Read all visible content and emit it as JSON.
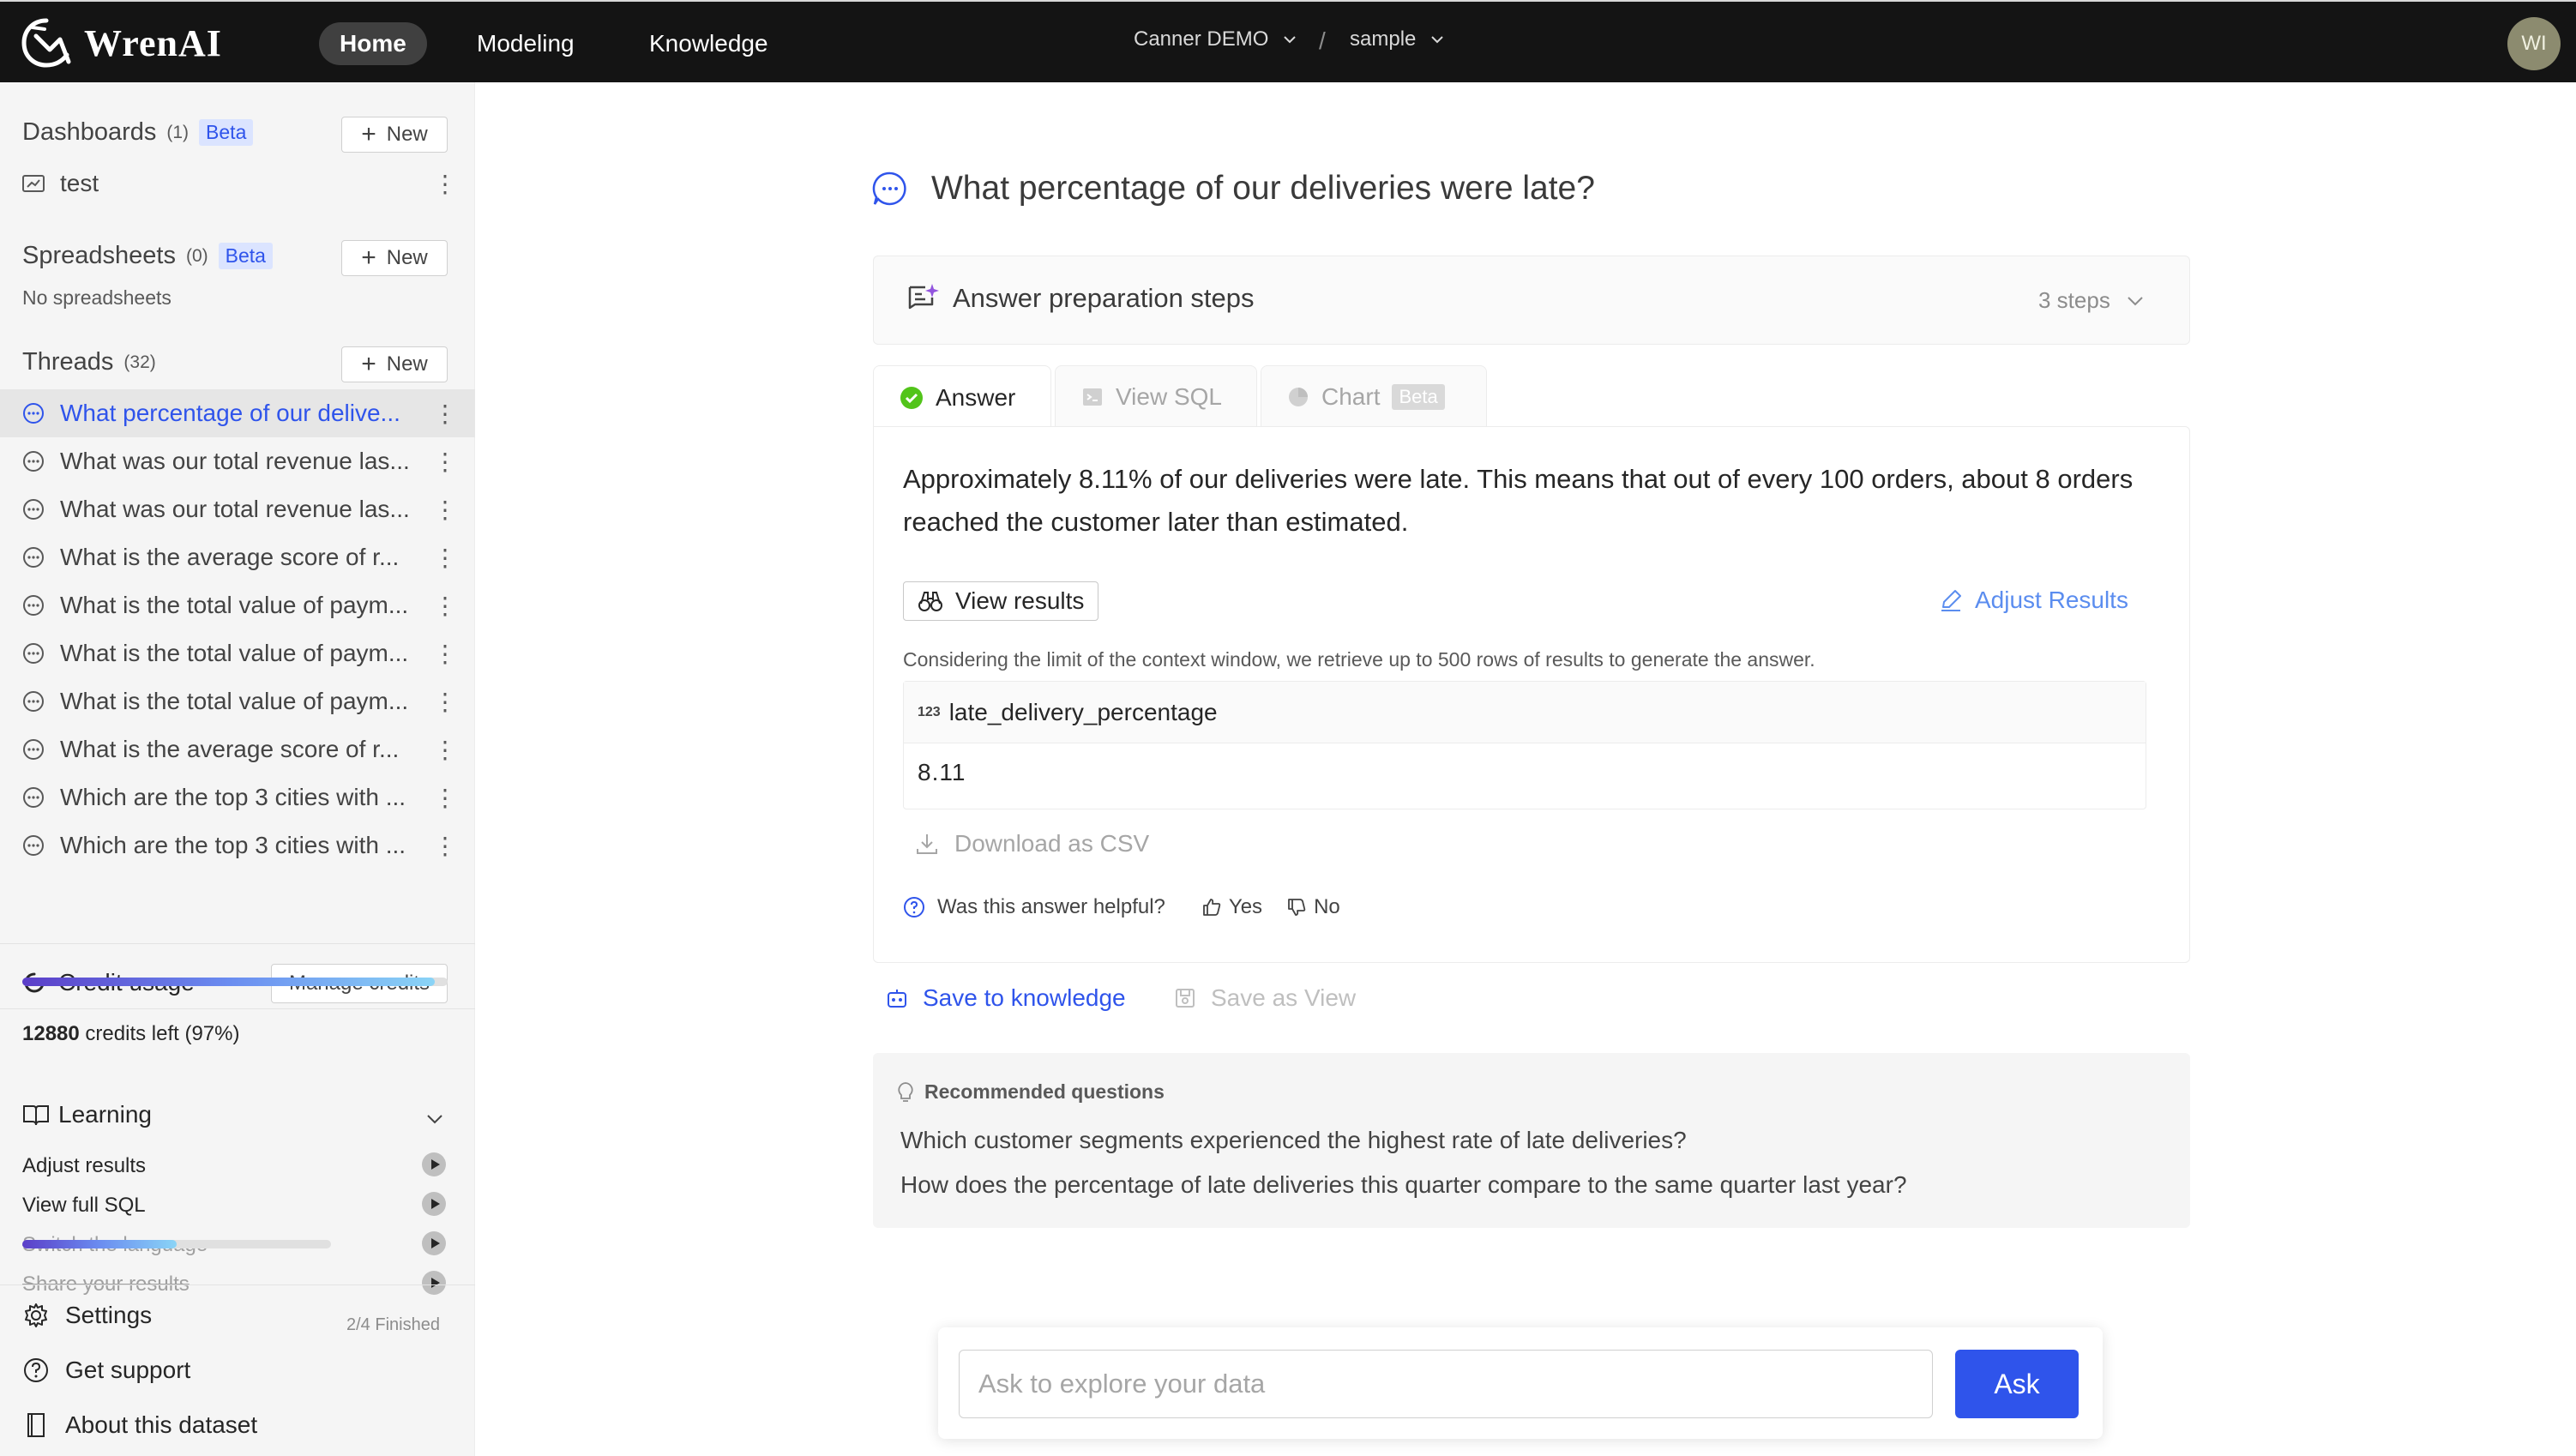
{
  "header": {
    "logo_text": "WrenAI",
    "nav": {
      "home": "Home",
      "modeling": "Modeling",
      "knowledge": "Knowledge"
    },
    "project": "Canner DEMO",
    "separator": "/",
    "dataset": "sample",
    "avatar_initials": "WI"
  },
  "sidebar": {
    "dashboards": {
      "title": "Dashboards",
      "count": "(1)",
      "badge": "Beta",
      "new_label": "New",
      "items": [
        {
          "label": "test"
        }
      ]
    },
    "spreadsheets": {
      "title": "Spreadsheets",
      "count": "(0)",
      "badge": "Beta",
      "new_label": "New",
      "empty_text": "No spreadsheets"
    },
    "threads": {
      "title": "Threads",
      "count": "(32)",
      "new_label": "New",
      "items": [
        {
          "label": "What percentage of our delive..."
        },
        {
          "label": "What was our total revenue las..."
        },
        {
          "label": "What was our total revenue las..."
        },
        {
          "label": "What is the average score of r..."
        },
        {
          "label": "What is the total value of paym..."
        },
        {
          "label": "What is the total value of paym..."
        },
        {
          "label": "What is the total value of paym..."
        },
        {
          "label": "What is the average score of r..."
        },
        {
          "label": "Which are the top 3 cities with ..."
        },
        {
          "label": "Which are the top 3 cities with ..."
        }
      ]
    },
    "credit": {
      "title": "Credit usage",
      "manage_label": "Manage credits",
      "amount": "12880",
      "suffix": "credits left (97%)",
      "percent": 97
    },
    "learning": {
      "title": "Learning",
      "items": [
        {
          "label": "Adjust results",
          "done": false
        },
        {
          "label": "View full SQL",
          "done": false
        },
        {
          "label": "Switch the language",
          "done": true
        },
        {
          "label": "Share your results",
          "done": true
        }
      ],
      "progress_text": "2/4 Finished",
      "progress": 0.5
    },
    "footer": {
      "settings": "Settings",
      "support": "Get support",
      "about": "About this dataset"
    }
  },
  "main": {
    "question": "What percentage of our deliveries were late?",
    "prep": {
      "label": "Answer preparation steps",
      "steps": "3 steps"
    },
    "tabs": {
      "answer": "Answer",
      "sql": "View SQL",
      "chart": "Chart",
      "chart_badge": "Beta"
    },
    "answer_text": "Approximately 8.11% of our deliveries were late. This means that out of every 100 orders, about 8 orders reached the customer later than estimated.",
    "view_results_label": "View results",
    "adjust_label": "Adjust Results",
    "context_note": "Considering the limit of the context window, we retrieve up to 500 rows of results to generate the answer.",
    "table": {
      "type_badge": "123",
      "column": "late_delivery_percentage",
      "value": "8.11"
    },
    "download_label": "Download as CSV",
    "feedback": {
      "question": "Was this answer helpful?",
      "yes": "Yes",
      "no": "No"
    },
    "save_knowledge": "Save to knowledge",
    "save_view": "Save as View",
    "recommended": {
      "title": "Recommended questions",
      "items": [
        "Which customer segments experienced the highest rate of late deliveries?",
        "How does the percentage of late deliveries this quarter compare to the same quarter last year?"
      ]
    },
    "ask": {
      "placeholder": "Ask to explore your data",
      "button": "Ask"
    }
  },
  "colors": {
    "accent": "#2f54eb",
    "topbar": "#141414",
    "sidebar": "#f5f5f5",
    "success": "#52c41a"
  }
}
